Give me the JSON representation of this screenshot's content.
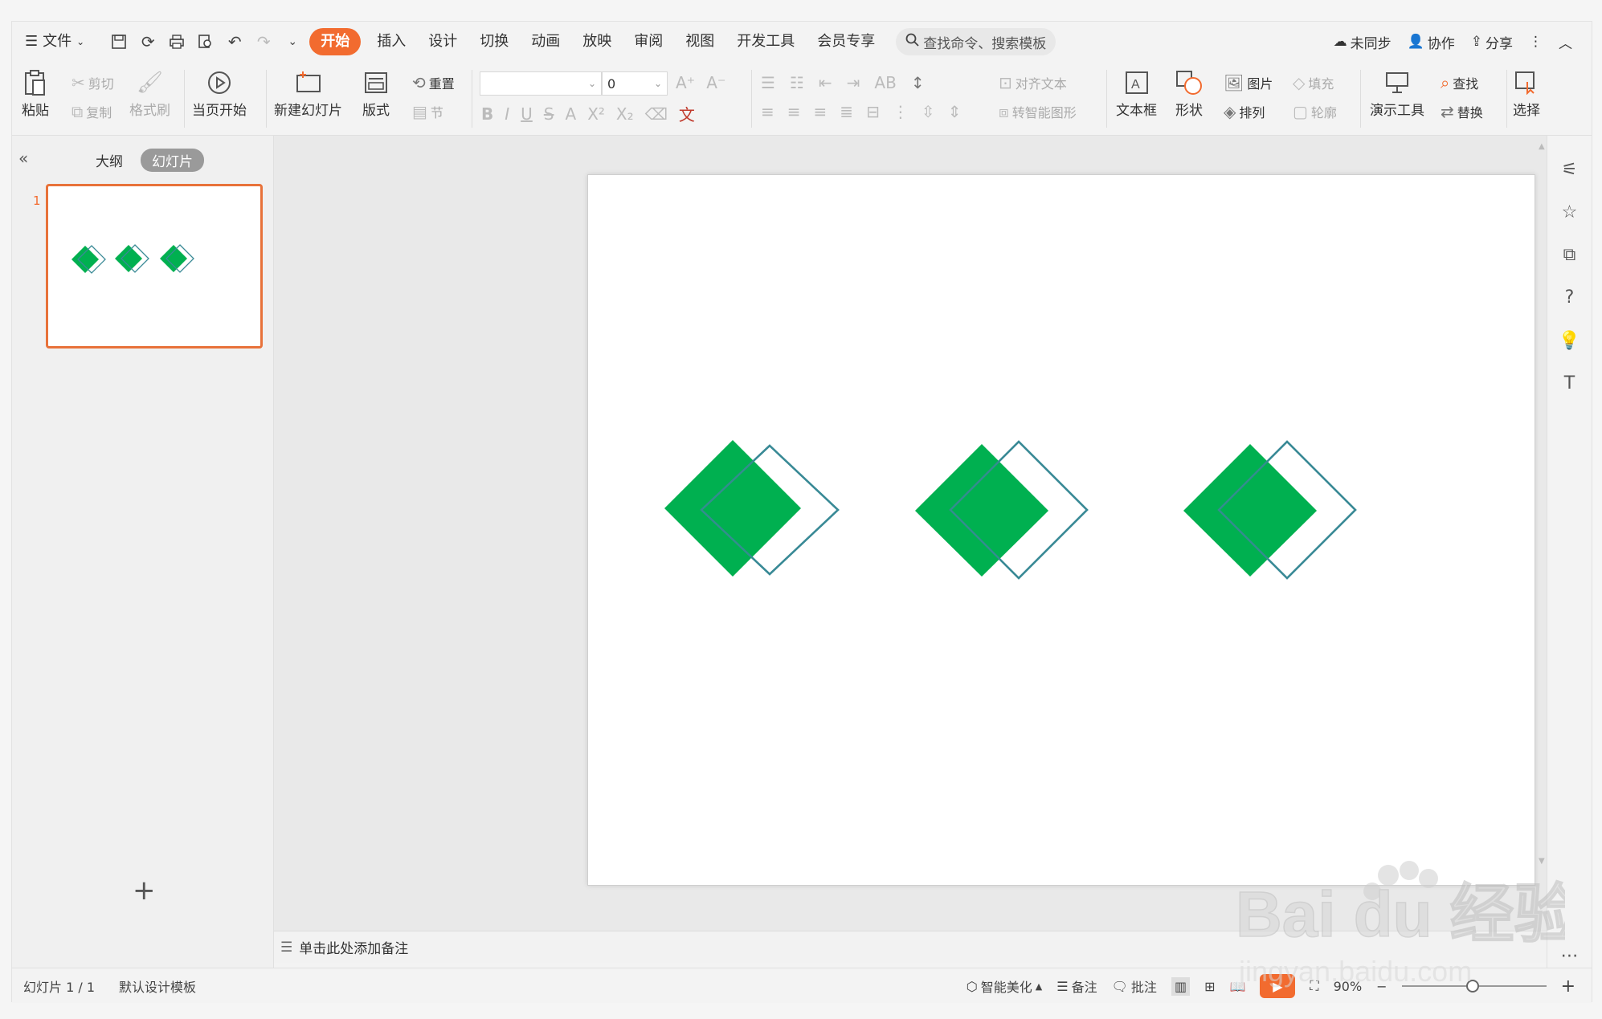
{
  "menubar": {
    "file_label": "文件",
    "tabs": [
      "开始",
      "插入",
      "设计",
      "切换",
      "动画",
      "放映",
      "审阅",
      "视图",
      "开发工具",
      "会员专享"
    ],
    "active_tab": "开始",
    "search_placeholder": "查找命令、搜索模板",
    "right": {
      "sync": "未同步",
      "collab": "协作",
      "share": "分享"
    }
  },
  "toolbar": {
    "paste": "粘贴",
    "cut": "剪切",
    "copy": "复制",
    "format_painter": "格式刷",
    "start_from_current": "当页开始",
    "new_slide": "新建幻灯片",
    "layout": "版式",
    "reset": "重置",
    "section": "节",
    "font_size_value": "0",
    "align_text": "对齐文本",
    "to_smartart": "转智能图形",
    "textbox": "文本框",
    "shape": "形状",
    "picture": "图片",
    "arrange": "排列",
    "fill": "填充",
    "outline": "轮廓",
    "present_tool": "演示工具",
    "find": "查找",
    "replace": "替换",
    "select": "选择"
  },
  "leftpanel": {
    "tab_outline": "大纲",
    "tab_slides": "幻灯片",
    "slide_number": "1"
  },
  "notes_placeholder": "单击此处添加备注",
  "statusbar": {
    "slide_info": "幻灯片 1 / 1",
    "template": "默认设计模板",
    "smart_beautify": "智能美化",
    "notes": "备注",
    "comments": "批注",
    "zoom": "90%"
  },
  "watermark": {
    "brand": "Bai du 经验",
    "url": "jingyan.baidu.com"
  },
  "colors": {
    "accent": "#f26b2f",
    "diamond_fill": "#00b050",
    "diamond_outline": "#3a8a96"
  },
  "slide_content": {
    "diamond_pairs": 3
  }
}
